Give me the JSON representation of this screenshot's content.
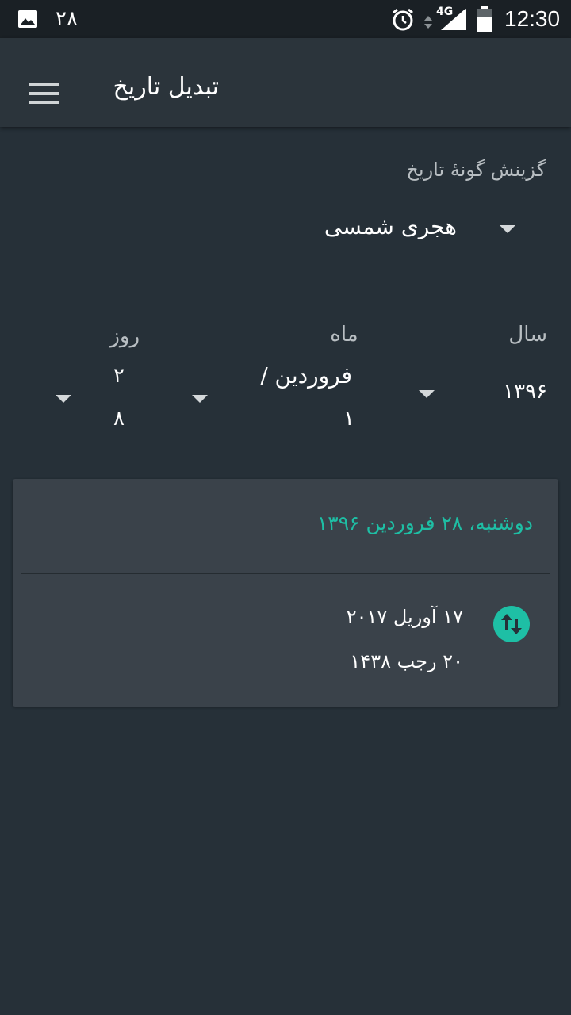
{
  "status_bar": {
    "notification_count": "۲۸",
    "network": "4G",
    "time": "12:30"
  },
  "app_bar": {
    "title": "تبدیل تاریخ"
  },
  "calendar_type": {
    "label": "گزینش گونهٔ تاریخ",
    "selected": "هجری شمسی"
  },
  "date_picker": {
    "year_label": "سال",
    "year_value": "۱۳۹۶",
    "month_label": "ماه",
    "month_value": "فروردین /",
    "month_number": "۱",
    "day_label": "روز",
    "day_value_top": "۲",
    "day_value_bottom": "۸"
  },
  "result": {
    "header": "دوشنبه، ۲۸ فروردین ۱۳۹۶",
    "gregorian": "۱۷ آوریل ۲۰۱۷",
    "hijri": "۲۰ رجب ۱۴۳۸"
  },
  "colors": {
    "background": "#263038",
    "app_bar": "#2b343b",
    "card": "#3a424a",
    "accent": "#1ebfa5"
  }
}
